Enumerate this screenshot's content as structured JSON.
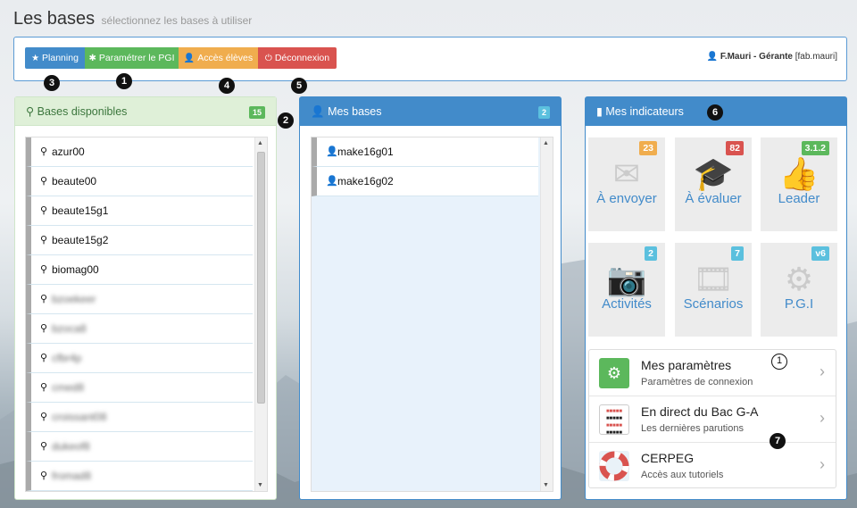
{
  "page": {
    "title": "Les bases",
    "subtitle": "sélectionnez les bases à utiliser"
  },
  "toolbar": {
    "planning_label": "Planning",
    "pgi_label": "Paramétrer le PGI",
    "eleves_label": "Accès élèves",
    "deconnexion_label": "Déconnexion",
    "user_name": "F.Mauri - Gérante",
    "user_login": "[fab.mauri]"
  },
  "markers": {
    "m1": "1",
    "m2": "2",
    "m3": "3",
    "m4": "4",
    "m5": "5",
    "m6": "6",
    "m7": "7",
    "m_circle_1": "1"
  },
  "bases_disponibles": {
    "title": "Bases disponibles",
    "count": "15",
    "items": [
      {
        "label": "azur00",
        "blurred": false
      },
      {
        "label": "beaute00",
        "blurred": false
      },
      {
        "label": "beaute15g1",
        "blurred": false
      },
      {
        "label": "beaute15g2",
        "blurred": false
      },
      {
        "label": "biomag00",
        "blurred": false
      },
      {
        "label": "bzoekeer",
        "blurred": true
      },
      {
        "label": "bzoca8",
        "blurred": true
      },
      {
        "label": "cfbr4p",
        "blurred": true
      },
      {
        "label": "cmed8",
        "blurred": true
      },
      {
        "label": "croissant08",
        "blurred": true
      },
      {
        "label": "dukeof8",
        "blurred": true
      },
      {
        "label": "fromad8",
        "blurred": true
      }
    ]
  },
  "mes_bases": {
    "title": "Mes bases",
    "count": "2",
    "items": [
      {
        "label": "make16g01"
      },
      {
        "label": "make16g02"
      }
    ]
  },
  "indicateurs": {
    "title": "Mes indicateurs",
    "tiles": [
      {
        "label": "À envoyer",
        "badge": "23",
        "badge_color": "#f0ad4e",
        "icon": "envelope-icon"
      },
      {
        "label": "À évaluer",
        "badge": "82",
        "badge_color": "#d9534f",
        "icon": "graduation-cap-icon"
      },
      {
        "label": "Leader",
        "badge": "3.1.2",
        "badge_color": "#5cb85c",
        "icon": "thumbs-up-icon"
      },
      {
        "label": "Activités",
        "badge": "2",
        "badge_color": "#5bc0de",
        "icon": "camera-icon"
      },
      {
        "label": "Scénarios",
        "badge": "7",
        "badge_color": "#5bc0de",
        "icon": "video-file-icon"
      },
      {
        "label": "P.G.I",
        "badge": "v6",
        "badge_color": "#5bc0de",
        "icon": "gears-icon"
      }
    ],
    "menu": [
      {
        "title": "Mes paramètres",
        "subtitle": "Paramètres de connexion",
        "icon": "settings-icon"
      },
      {
        "title": "En direct du Bac G-A",
        "subtitle": "Les dernières parutions",
        "icon": "bac-ga-logo-icon"
      },
      {
        "title": "CERPEG",
        "subtitle": "Accès aux tutoriels",
        "icon": "lifebuoy-icon"
      }
    ]
  },
  "colors": {
    "primary": "#428bca",
    "success": "#5cb85c",
    "warning": "#f0ad4e",
    "danger": "#d9534f",
    "info": "#5bc0de"
  }
}
